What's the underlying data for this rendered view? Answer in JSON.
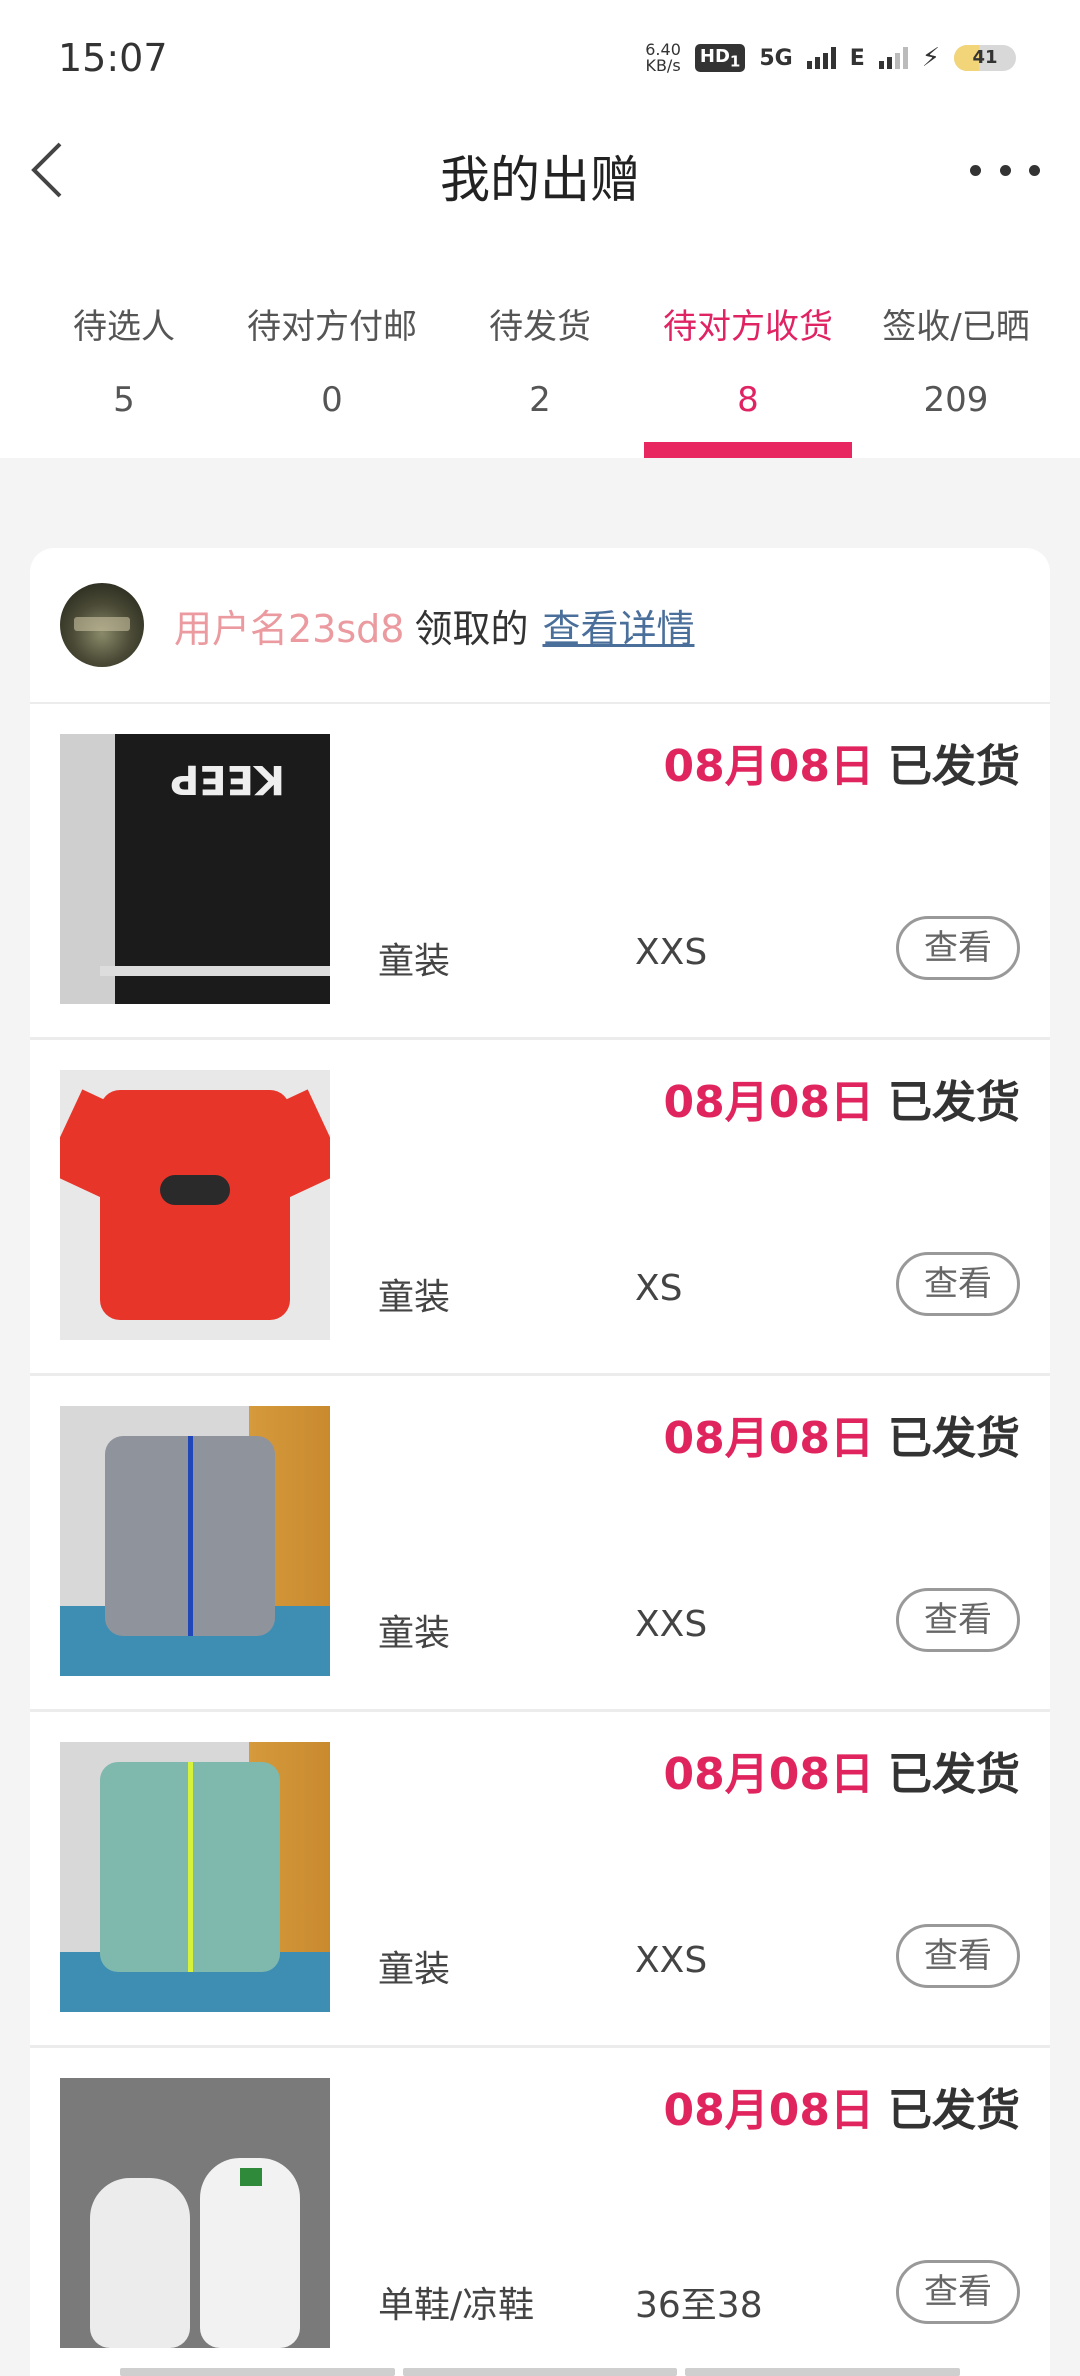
{
  "status_bar": {
    "time": "15:07",
    "net_speed_value": "6.40",
    "net_speed_unit": "KB/s",
    "hd_label": "HD",
    "hd_sub": "1",
    "network_1": "5G",
    "network_2": "E",
    "battery": "41"
  },
  "header": {
    "title": "我的出赠"
  },
  "tabs": [
    {
      "label": "待选人",
      "count": "5",
      "active": false
    },
    {
      "label": "待对方付邮",
      "count": "0",
      "active": false
    },
    {
      "label": "待发货",
      "count": "2",
      "active": false
    },
    {
      "label": "待对方收货",
      "count": "8",
      "active": true
    },
    {
      "label": "签收/已晒",
      "count": "209",
      "active": false
    }
  ],
  "card": {
    "user_name": "用户名23sd8",
    "claimed_text": "领取的",
    "details_link": "查看详情"
  },
  "items": [
    {
      "date": "08月08日",
      "status": "已发货",
      "category": "童装",
      "size": "XXS",
      "button": "查看"
    },
    {
      "date": "08月08日",
      "status": "已发货",
      "category": "童装",
      "size": "XS",
      "button": "查看"
    },
    {
      "date": "08月08日",
      "status": "已发货",
      "category": "童装",
      "size": "XXS",
      "button": "查看"
    },
    {
      "date": "08月08日",
      "status": "已发货",
      "category": "童装",
      "size": "XXS",
      "button": "查看"
    },
    {
      "date": "08月08日",
      "status": "已发货",
      "category": "单鞋/凉鞋",
      "size": "36至38",
      "button": "查看"
    }
  ],
  "colors": {
    "accent": "#e0245e",
    "user_name": "#eb9a9f",
    "link": "#4a6f9a"
  },
  "thumb_keep_text": "KEEP"
}
